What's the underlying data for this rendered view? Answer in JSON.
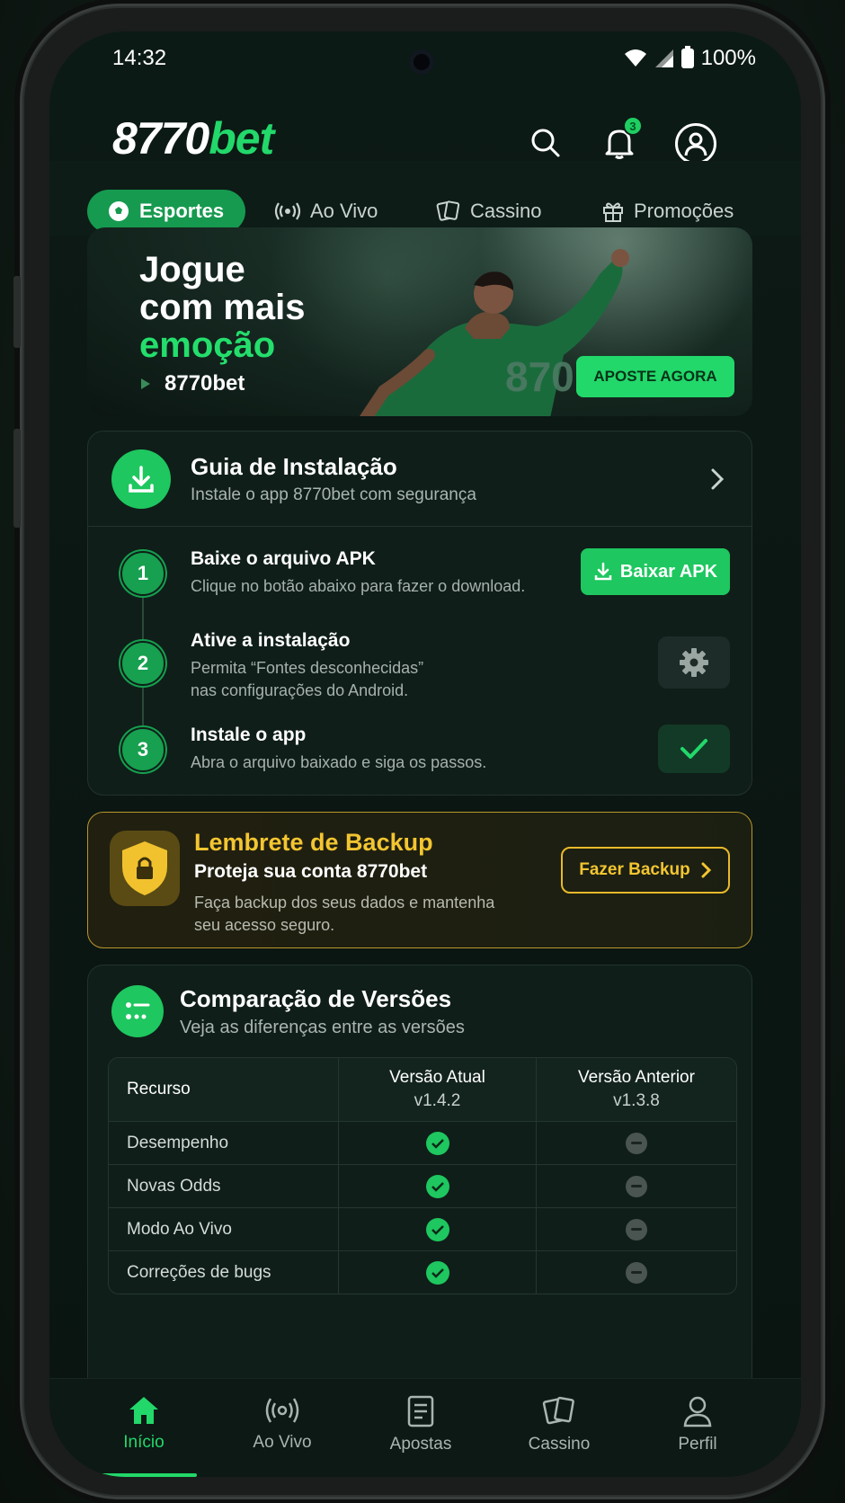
{
  "status": {
    "time": "14:32",
    "battery": "100%"
  },
  "header": {
    "logo_num": "8770",
    "logo_bet": "bet",
    "notifications": "3"
  },
  "tabs": [
    {
      "label": "Esportes",
      "icon": "soccer-ball-icon"
    },
    {
      "label": "Ao Vivo",
      "icon": "broadcast-icon"
    },
    {
      "label": "Cassino",
      "icon": "cards-icon"
    },
    {
      "label": "Promoções",
      "icon": "gift-icon"
    }
  ],
  "banner": {
    "line1": "Jogue",
    "line2": "com mais",
    "line3": "emoção",
    "brand": "8770bet",
    "jersey_number": "870",
    "cta": "APOSTE AGORA"
  },
  "guide": {
    "title": "Guia de Instalação",
    "subtitle": "Instale o app 8770bet com segurança",
    "steps": [
      {
        "num": "1",
        "title": "Baixe o arquivo APK",
        "desc": "Clique no botão abaixo para fazer o download."
      },
      {
        "num": "2",
        "title": "Ative a instalação",
        "desc1": "Permita “Fontes desconhecidas”",
        "desc2": "nas configurações do Android."
      },
      {
        "num": "3",
        "title": "Instale o app",
        "desc": "Abra o arquivo baixado e siga os passos."
      }
    ],
    "apk_button": "Baixar APK"
  },
  "backup": {
    "title": "Lembrete de Backup",
    "subtitle": "Proteja sua conta 8770bet",
    "desc1": "Faça backup dos seus dados e mantenha",
    "desc2": "seu acesso seguro.",
    "button": "Fazer Backup"
  },
  "compare": {
    "title": "Comparação de Versões",
    "subtitle": "Veja as diferenças entre as versões",
    "col_resource": "Recurso",
    "col_current": "Versão Atual",
    "col_current_ver": "v1.4.2",
    "col_previous": "Versão Anterior",
    "col_previous_ver": "v1.3.8",
    "rows": [
      {
        "label": "Desempenho",
        "current": true,
        "previous": false
      },
      {
        "label": "Novas Odds",
        "current": true,
        "previous": false
      },
      {
        "label": "Modo Ao Vivo",
        "current": true,
        "previous": false
      },
      {
        "label": "Correções de bugs",
        "current": true,
        "previous": false
      }
    ]
  },
  "bottom_nav": [
    {
      "label": "Início",
      "icon": "home-icon"
    },
    {
      "label": "Ao Vivo",
      "icon": "broadcast-icon"
    },
    {
      "label": "Apostas",
      "icon": "betslip-icon"
    },
    {
      "label": "Cassino",
      "icon": "cards-icon"
    },
    {
      "label": "Perfil",
      "icon": "user-icon"
    }
  ],
  "colors": {
    "accent": "#22d86a",
    "gold": "#f3c530",
    "bg": "#0c1a15"
  }
}
